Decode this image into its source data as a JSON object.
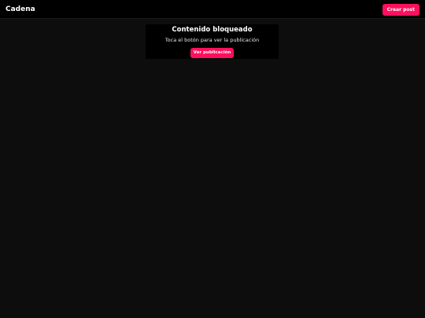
{
  "header": {
    "brand": "Cadena",
    "create_label": "Crear post"
  },
  "blocked": {
    "title": "Contenido bloqueado",
    "message": "Toca el botón para ver la publicación",
    "view_label": "Ver publicación"
  },
  "colors": {
    "accent": "#ff0f5c",
    "background": "#0d0d0d",
    "topbar": "#000000"
  }
}
